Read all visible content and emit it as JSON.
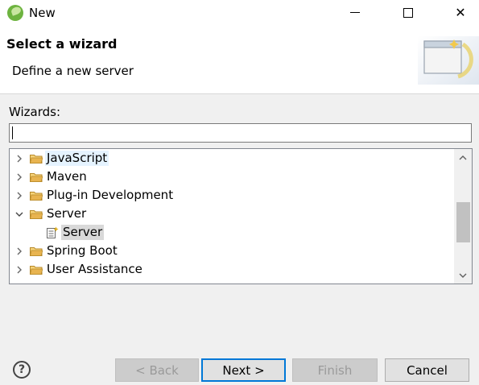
{
  "window": {
    "title": "New",
    "minimize_icon": "minimize-icon",
    "maximize_icon": "maximize-icon",
    "close_symbol": "✕"
  },
  "header": {
    "title": "Select a wizard",
    "description": "Define a new server"
  },
  "wizards": {
    "label": "Wizards:",
    "filter_value": "",
    "items": [
      {
        "label": "JavaScript",
        "expanded": false,
        "level": 0,
        "highlight": "hover"
      },
      {
        "label": "Maven",
        "expanded": false,
        "level": 0
      },
      {
        "label": "Plug-in Development",
        "expanded": false,
        "level": 0
      },
      {
        "label": "Server",
        "expanded": true,
        "level": 0
      },
      {
        "label": "Server",
        "level": 1,
        "selected": true
      },
      {
        "label": "Spring Boot",
        "expanded": false,
        "level": 0
      },
      {
        "label": "User Assistance",
        "expanded": false,
        "level": 0
      }
    ]
  },
  "buttons": {
    "back": "< Back",
    "next": "Next >",
    "finish": "Finish",
    "cancel": "Cancel",
    "help": "?"
  },
  "colors": {
    "accent": "#0078d7",
    "folder": "#e8b450",
    "hover": "#e5f3ff",
    "selected": "#d9d9d9"
  }
}
